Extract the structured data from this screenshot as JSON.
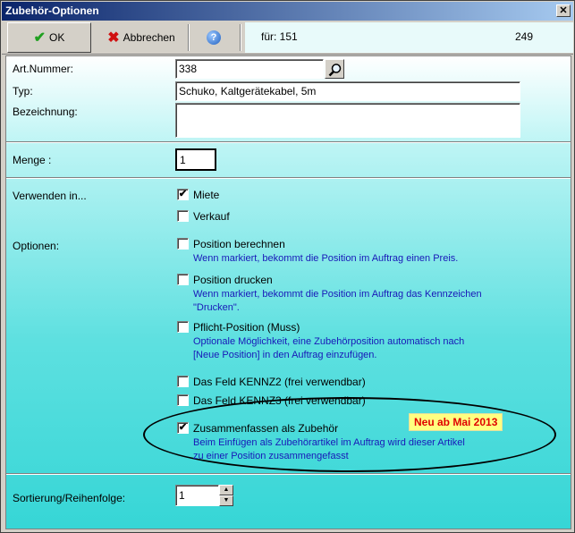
{
  "window": {
    "title": "Zubehör-Optionen",
    "close_glyph": "✕"
  },
  "toolbar": {
    "ok_label": "OK",
    "cancel_label": "Abbrechen",
    "help_glyph": "?",
    "info_fuer": "für: 151",
    "info_number": "249"
  },
  "form": {
    "art_nummer": {
      "label": "Art.Nummer:",
      "value": "338"
    },
    "typ": {
      "label": "Typ:",
      "value": "Schuko, Kaltgerätekabel, 5m"
    },
    "bezeichnung": {
      "label": "Bezeichnung:",
      "value": ""
    },
    "menge": {
      "label": "Menge :",
      "value": "1"
    },
    "verwenden": {
      "label": "Verwenden in...",
      "miete": {
        "label": "Miete",
        "checked": true
      },
      "verkauf": {
        "label": "Verkauf",
        "checked": false
      }
    },
    "optionen": {
      "label": "Optionen:",
      "items": [
        {
          "label": "Position berechnen",
          "checked": false,
          "desc": [
            "Wenn markiert, bekommt die Position im Auftrag einen Preis."
          ]
        },
        {
          "label": "Position drucken",
          "checked": false,
          "desc": [
            "Wenn markiert, bekommt die Position im Auftrag das Kennzeichen",
            "\"Drucken\"."
          ]
        },
        {
          "label": "Pflicht-Position (Muss)",
          "checked": false,
          "desc": [
            "Optionale Möglichkeit, eine Zubehörposition automatisch nach",
            "[Neue Position] in den Auftrag einzufügen."
          ]
        },
        {
          "label": "Das Feld KENNZ2 (frei verwendbar)",
          "checked": false,
          "desc": []
        },
        {
          "label": "Das Feld KENNZ3 (frei verwendbar)",
          "checked": false,
          "desc": []
        },
        {
          "label": "Zusammenfassen als Zubehör",
          "checked": true,
          "desc": [
            "Beim Einfügen als Zubehörartikel im Auftrag wird dieser Artikel",
            "zu einer Position zusammengefasst"
          ]
        }
      ],
      "badge": "Neu ab Mai 2013"
    },
    "sortierung": {
      "label": "Sortierung/Reihenfolge:",
      "value": "1"
    }
  },
  "colors": {
    "title_start": "#0a246a",
    "desc_text": "#1818b8",
    "badge_bg": "#ffff80",
    "badge_text": "#e00000"
  }
}
